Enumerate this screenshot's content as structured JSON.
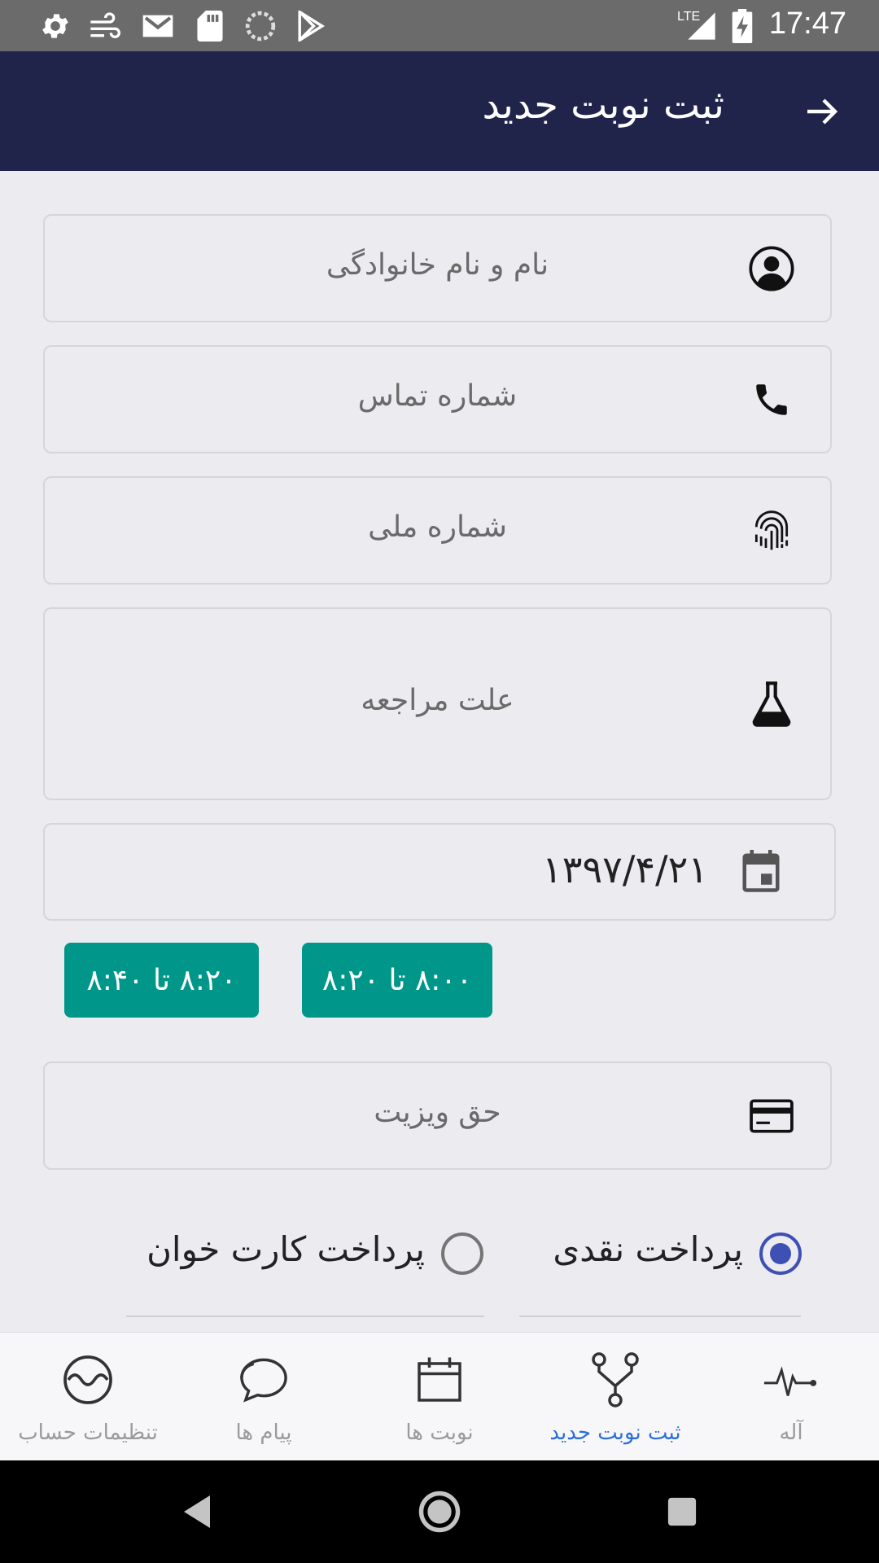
{
  "status_bar": {
    "time": "17:47",
    "network": "LTE",
    "icons": [
      "settings-icon",
      "weather-icon",
      "mail-icon",
      "sd-card-icon",
      "sync-icon",
      "play-store-icon",
      "signal-icon",
      "battery-charging-icon"
    ]
  },
  "app_bar": {
    "title": "ثبت نوبت جدید",
    "back_icon": "arrow-right-icon"
  },
  "form": {
    "name_placeholder": "نام و نام خانوادگی",
    "phone_placeholder": "شماره تماس",
    "national_id_placeholder": "شماره ملی",
    "reason_placeholder": "علت مراجعه",
    "date_value": "۱۳۹۷/۴/۲۱",
    "fee_placeholder": "حق ویزیت"
  },
  "time_slots": [
    {
      "label": "۸:۰۰ تا ۸:۲۰"
    },
    {
      "label": "۸:۲۰ تا ۸:۴۰"
    }
  ],
  "payment": {
    "cash_label": "پرداخت نقدی",
    "card_label": "پرداخت کارت خوان",
    "selected": "cash"
  },
  "bottom_nav": {
    "items": [
      {
        "label": "آله",
        "icon": "pulse-icon",
        "active": false
      },
      {
        "label": "ثبت نوبت جدید",
        "icon": "branch-icon",
        "active": true
      },
      {
        "label": "نوبت ها",
        "icon": "calendar-icon",
        "active": false
      },
      {
        "label": "پیام ها",
        "icon": "chat-icon",
        "active": false
      },
      {
        "label": "تنظیمات حساب",
        "icon": "wave-circle-icon",
        "active": false
      }
    ]
  },
  "colors": {
    "app_bar": "#20244b",
    "accent_teal": "#00978a",
    "radio_active": "#3e50b4",
    "nav_active": "#2b6fd6"
  }
}
